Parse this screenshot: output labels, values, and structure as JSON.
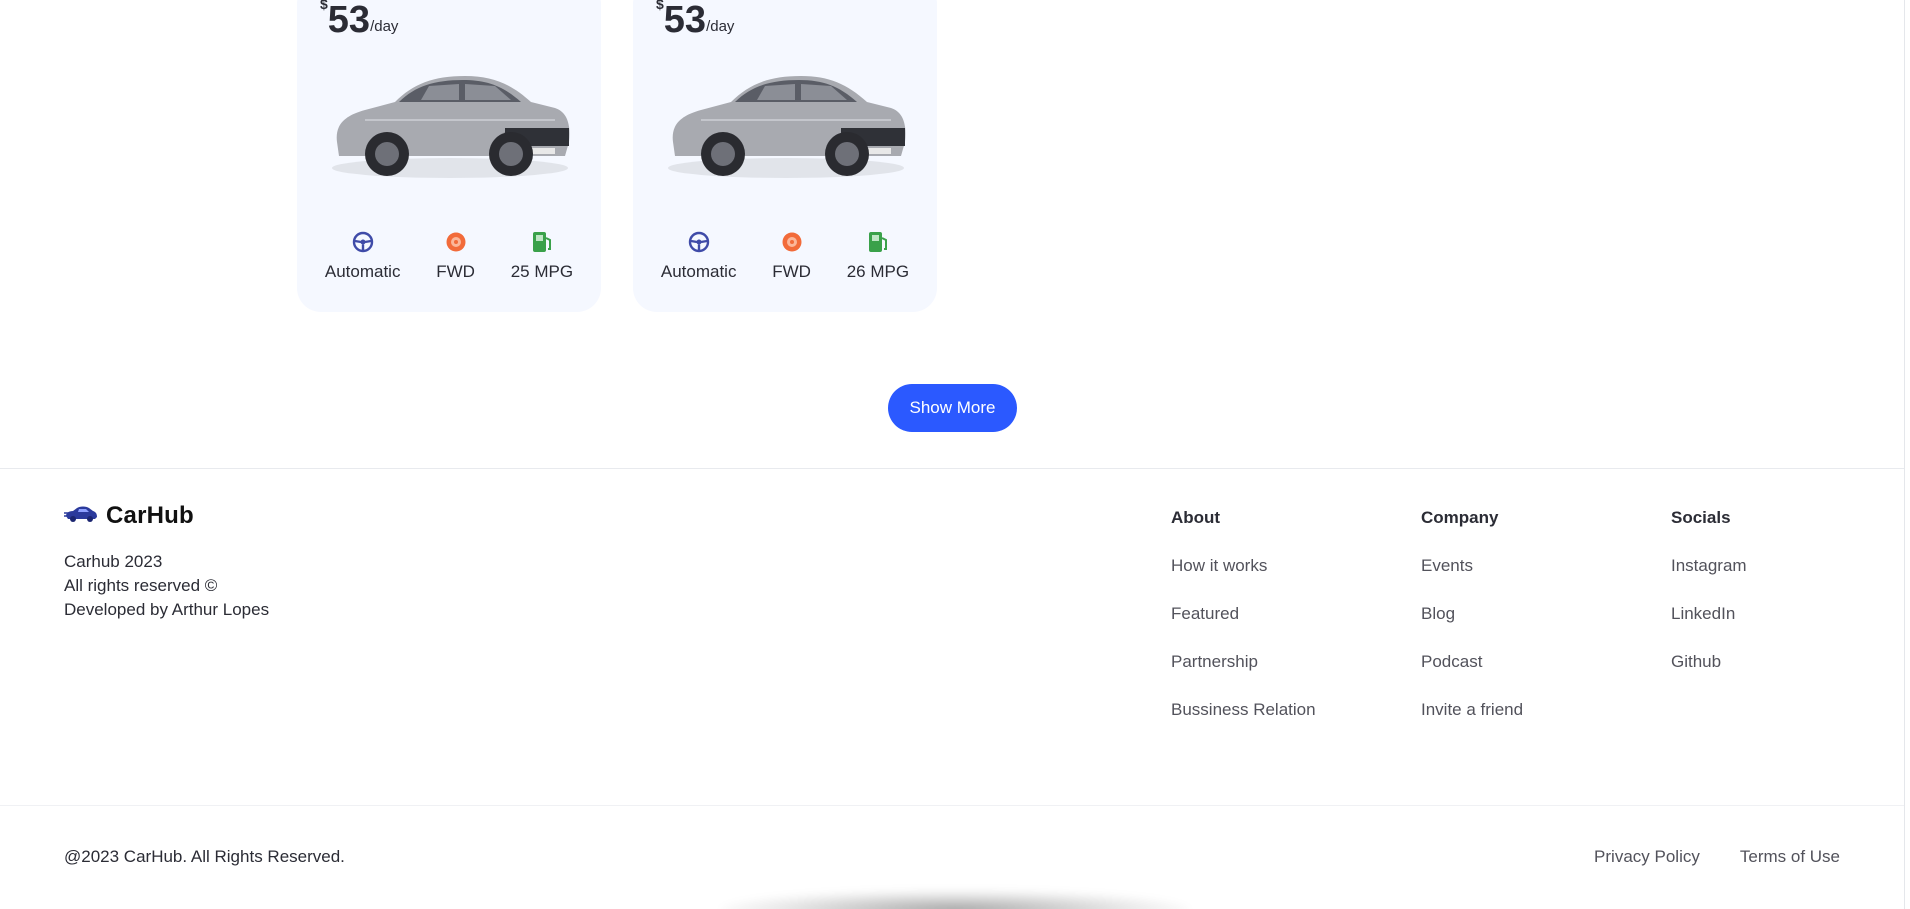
{
  "cards": [
    {
      "currency": "$",
      "price": "53",
      "per": "/day",
      "specs": {
        "transmission": "Automatic",
        "drive": "FWD",
        "mpg": "25 MPG"
      }
    },
    {
      "currency": "$",
      "price": "53",
      "per": "/day",
      "specs": {
        "transmission": "Automatic",
        "drive": "FWD",
        "mpg": "26 MPG"
      }
    }
  ],
  "show_more_label": "Show More",
  "footer": {
    "brand": "CarHub",
    "info": [
      "Carhub 2023",
      "All rights reserved ©",
      "Developed by Arthur Lopes"
    ],
    "columns": {
      "about": {
        "title": "About",
        "links": [
          "How it works",
          "Featured",
          "Partnership",
          "Bussiness Relation"
        ]
      },
      "company": {
        "title": "Company",
        "links": [
          "Events",
          "Blog",
          "Podcast",
          "Invite a friend"
        ]
      },
      "socials": {
        "title": "Socials",
        "links": [
          "Instagram",
          "LinkedIn",
          "Github"
        ]
      }
    },
    "copyright": "@2023 CarHub. All Rights Reserved.",
    "privacy": "Privacy Policy",
    "terms": "Terms of Use"
  },
  "colors": {
    "accent": "#2b59ff",
    "card_bg": "#f5f8ff",
    "steering_icon": "#3f4ba8",
    "tire_icon": "#f26b3a",
    "gas_icon": "#3aa14a"
  }
}
